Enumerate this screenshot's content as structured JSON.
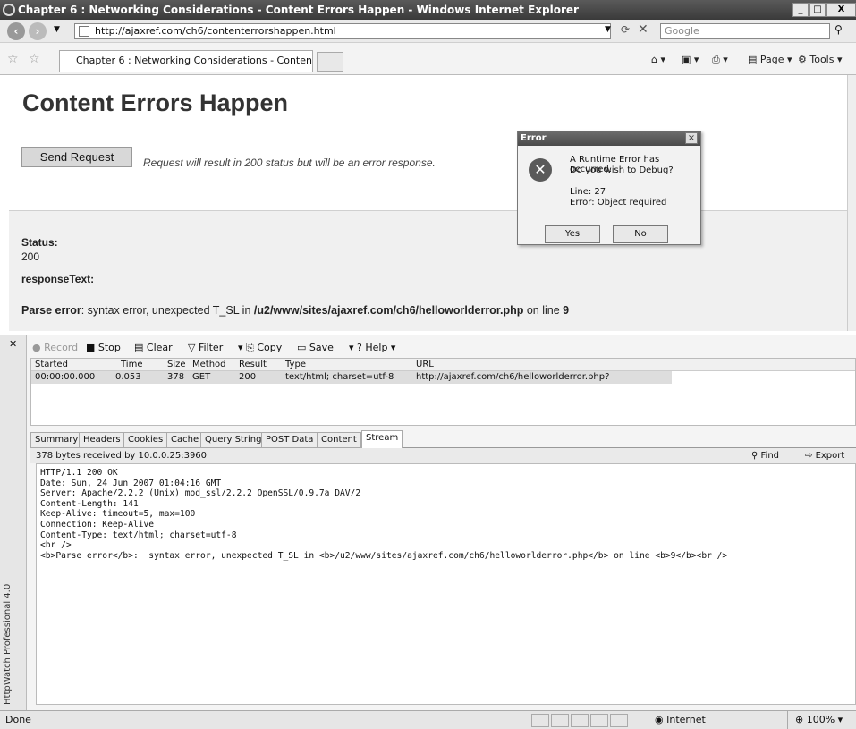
{
  "window": {
    "title": "Chapter 6 : Networking Considerations - Content Errors Happen - Windows Internet Explorer"
  },
  "address": {
    "url": "http://ajaxref.com/ch6/contenterrorshappen.html",
    "search_placeholder": "Google"
  },
  "tab": {
    "label": "Chapter 6 : Networking Considerations - Content Erro..."
  },
  "toolbar": {
    "page": "Page",
    "tools": "Tools"
  },
  "page": {
    "heading": "Content Errors Happen",
    "send_button": "Send Request",
    "hint": "Request will result in 200 status but will be an error response.",
    "status_label": "Status:",
    "status_value": "200",
    "response_label": "responseText:",
    "parse_label": "Parse error",
    "parse_text": ": syntax error, unexpected T_SL in ",
    "parse_path": "/u2/www/sites/ajaxref.com/ch6/helloworlderror.php",
    "parse_on": " on line ",
    "parse_line": "9"
  },
  "dialog": {
    "title": "Error",
    "line1": "A Runtime Error has occurred.",
    "line2": "Do you wish to Debug?",
    "line3": "Line: 27",
    "line4": "Error: Object required",
    "yes": "Yes",
    "no": "No"
  },
  "httpwatch": {
    "side_label": "HttpWatch Professional 4.0",
    "record": "Record",
    "stop": "Stop",
    "clear": "Clear",
    "filter": "Filter",
    "copy": "Copy",
    "save": "Save",
    "help": "Help",
    "columns": [
      "Started",
      "Time",
      "Size",
      "Method",
      "Result",
      "Type",
      "URL"
    ],
    "row": [
      "00:00:00.000",
      "0.053",
      "378",
      "GET",
      "200",
      "text/html; charset=utf-8",
      "http://ajaxref.com/ch6/helloworlderror.php?"
    ],
    "tabs": [
      "Summary",
      "Headers",
      "Cookies",
      "Cache",
      "Query String",
      "POST Data",
      "Content",
      "Stream"
    ],
    "info": "378 bytes received by 10.0.0.25:3960",
    "find": "Find",
    "export": "Export",
    "stream": [
      "HTTP/1.1 200 OK",
      "Date: Sun, 24 Jun 2007 01:04:16 GMT",
      "Server: Apache/2.2.2 (Unix) mod_ssl/2.2.2 OpenSSL/0.9.7a DAV/2",
      "Content-Length: 141",
      "Keep-Alive: timeout=5, max=100",
      "Connection: Keep-Alive",
      "Content-Type: text/html; charset=utf-8",
      "",
      "<br />",
      "<b>Parse error</b>:  syntax error, unexpected T_SL in <b>/u2/www/sites/ajaxref.com/ch6/helloworlderror.php</b> on line <b>9</b><br />"
    ]
  },
  "statusbar": {
    "left": "Done",
    "zone": "Internet",
    "zoom": "100%"
  }
}
